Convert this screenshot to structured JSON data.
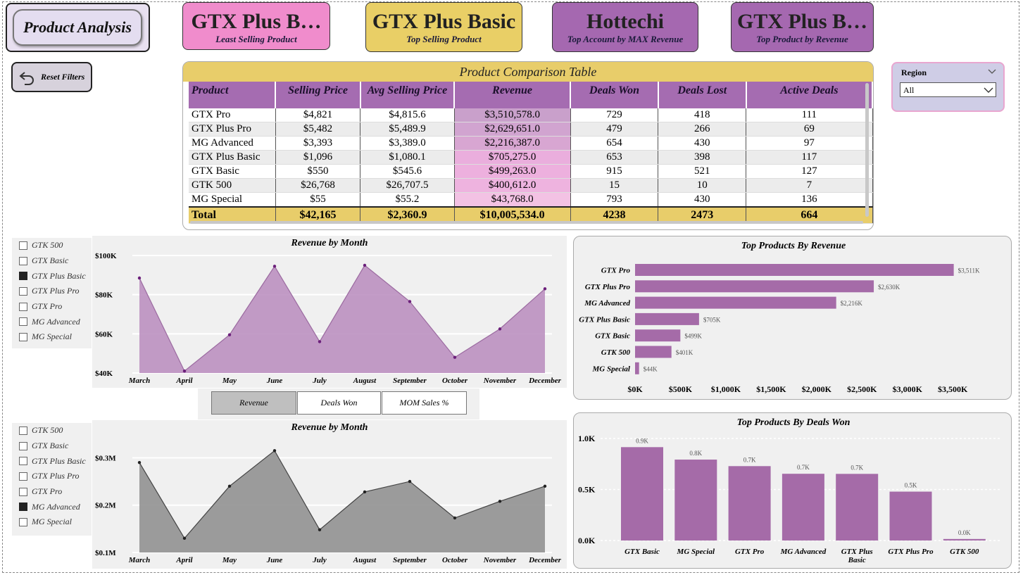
{
  "title": "Product Analysis",
  "reset_label": "Reset Filters",
  "kpis": [
    {
      "value": "GTX Plus B…",
      "label": "Least Selling Product",
      "bg": "#f08ccc"
    },
    {
      "value": "GTX Plus Basic",
      "label": "Top Selling Product",
      "bg": "#e9cf66"
    },
    {
      "value": "Hottechi",
      "label": "Top Account by MAX Revenue",
      "bg": "#a568b0"
    },
    {
      "value": "GTX Plus B…",
      "label": "Top Product by Revenue",
      "bg": "#a568b0"
    }
  ],
  "table": {
    "title": "Product Comparison Table",
    "columns": [
      "Product",
      "Selling Price",
      "Avg Selling Price",
      "Revenue",
      "Deals Won",
      "Deals Lost",
      "Active Deals"
    ],
    "rows": [
      [
        "GTX Pro",
        "$4,821",
        "$4,815.6",
        "$3,510,578.0",
        "729",
        "418",
        "111"
      ],
      [
        "GTX Plus Pro",
        "$5,482",
        "$5,489.9",
        "$2,629,651.0",
        "479",
        "266",
        "69"
      ],
      [
        "MG Advanced",
        "$3,393",
        "$3,389.0",
        "$2,216,387.0",
        "654",
        "430",
        "97"
      ],
      [
        "GTX Plus Basic",
        "$1,096",
        "$1,080.1",
        "$705,275.0",
        "653",
        "398",
        "117"
      ],
      [
        "GTX Basic",
        "$550",
        "$545.6",
        "$499,263.0",
        "915",
        "521",
        "127"
      ],
      [
        "GTK 500",
        "$26,768",
        "$26,707.5",
        "$400,612.0",
        "15",
        "10",
        "7"
      ],
      [
        "MG Special",
        "$55",
        "$55.2",
        "$43,768.0",
        "793",
        "430",
        "136"
      ]
    ],
    "revenue_shades": [
      "#c9a0cb",
      "#d1a4d0",
      "#d8a6d2",
      "#eaaedd",
      "#edb0de",
      "#eeb3df",
      "#f3c2e4"
    ],
    "total": [
      "Total",
      "$42,165",
      "$2,360.9",
      "$10,005,534.0",
      "4238",
      "2473",
      "664"
    ]
  },
  "region": {
    "label": "Region",
    "value": "All"
  },
  "slicer_items": [
    "GTK 500",
    "GTX Basic",
    "GTX Plus Basic",
    "GTX Plus Pro",
    "GTX Pro",
    "MG Advanced",
    "MG Special"
  ],
  "slicer1_selected": "GTX Plus Basic",
  "slicer2_selected": "MG Advanced",
  "toggle_buttons": [
    "Revenue",
    "Deals Won",
    "MOM Sales %"
  ],
  "toggle_active": "Revenue",
  "colors": {
    "purple": "#a56ba8",
    "purple_fill": "#b98bbd",
    "gray_fill": "#8c8c8c",
    "gold": "#e8cd6a"
  },
  "chart_data": [
    {
      "type": "area",
      "title": "Revenue by Month",
      "categories": [
        "March",
        "April",
        "May",
        "June",
        "July",
        "August",
        "September",
        "October",
        "November",
        "December"
      ],
      "values": [
        88500,
        41000,
        59500,
        94500,
        56000,
        95000,
        76500,
        48000,
        62500,
        83000
      ],
      "yticks": [
        "$40K",
        "$60K",
        "$80K",
        "$100K"
      ],
      "ytick_values": [
        40000,
        60000,
        80000,
        100000
      ],
      "ylim": [
        40000,
        100000
      ],
      "color": "purple"
    },
    {
      "type": "area",
      "title": "Revenue by Month",
      "categories": [
        "March",
        "April",
        "May",
        "June",
        "July",
        "August",
        "September",
        "October",
        "November",
        "December"
      ],
      "values": [
        290000,
        130000,
        240000,
        315000,
        148000,
        228000,
        250000,
        173000,
        208000,
        240000
      ],
      "yticks": [
        "$0.1M",
        "$0.2M",
        "$0.3M"
      ],
      "ytick_values": [
        100000,
        200000,
        300000
      ],
      "ylim": [
        100000,
        320000
      ],
      "color": "gray"
    },
    {
      "type": "bar",
      "orientation": "horizontal",
      "title": "Top Products By Revenue",
      "categories": [
        "GTX Pro",
        "GTX Plus Pro",
        "MG Advanced",
        "GTX Plus Basic",
        "GTX Basic",
        "GTK 500",
        "MG Special"
      ],
      "values": [
        3511,
        2630,
        2216,
        705,
        499,
        401,
        44
      ],
      "data_labels": [
        "$3,511K",
        "$2,630K",
        "$2,216K",
        "$705K",
        "$499K",
        "$401K",
        "$44K"
      ],
      "xticks": [
        "$0K",
        "$500K",
        "$1,000K",
        "$1,500K",
        "$2,000K",
        "$2,500K",
        "$3,000K",
        "$3,500K"
      ],
      "xlim": [
        0,
        3700
      ]
    },
    {
      "type": "bar",
      "title": "Top Products By Deals Won",
      "categories": [
        "GTX Basic",
        "MG Special",
        "GTX Pro",
        "MG Advanced",
        "GTX Plus Basic",
        "GTX Plus Pro",
        "GTK 500"
      ],
      "values": [
        0.915,
        0.793,
        0.729,
        0.654,
        0.653,
        0.479,
        0.015
      ],
      "data_labels": [
        "0.9K",
        "0.8K",
        "0.7K",
        "0.7K",
        "0.7K",
        "0.5K",
        "0.0K"
      ],
      "yticks": [
        "0.0K",
        "0.5K",
        "1.0K"
      ],
      "ytick_values": [
        0,
        0.5,
        1.0
      ],
      "ylim": [
        0,
        1.0
      ]
    }
  ]
}
